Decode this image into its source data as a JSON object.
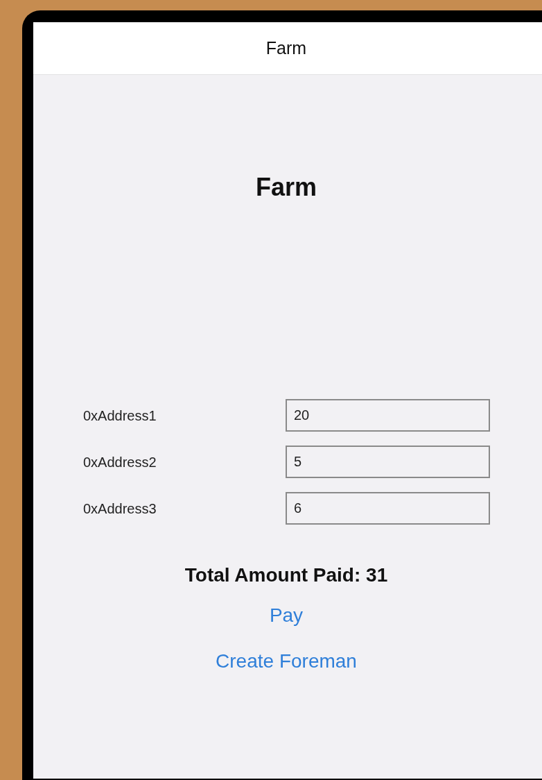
{
  "nav_bar": {
    "title": "Farm"
  },
  "heading": "Farm",
  "rows": [
    {
      "label": "0xAddress1",
      "value": "20"
    },
    {
      "label": "0xAddress2",
      "value": "5"
    },
    {
      "label": "0xAddress3",
      "value": "6"
    }
  ],
  "total": "Total Amount Paid: 31",
  "buttons": [
    "Pay",
    "Create Foreman"
  ]
}
